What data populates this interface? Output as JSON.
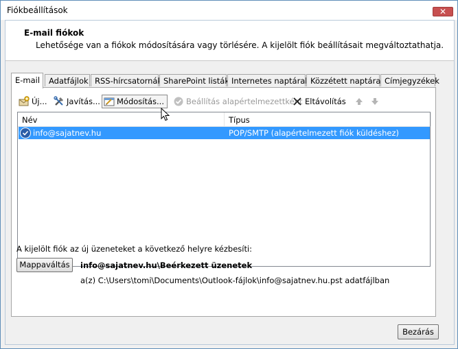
{
  "window": {
    "title": "Fiókbeállítások",
    "close_glyph": "✕"
  },
  "header": {
    "title": "E-mail fiókok",
    "description": "Lehetősége van a fiókok módosítására vagy törlésére. A kijelölt fiók beállításait megváltoztathatja."
  },
  "tabs": [
    {
      "label": "E-mail",
      "active": true
    },
    {
      "label": "Adatfájlok"
    },
    {
      "label": "RSS-hírcsatornák"
    },
    {
      "label": "SharePoint listák"
    },
    {
      "label": "Internetes naptárak"
    },
    {
      "label": "Közzétett naptárak"
    },
    {
      "label": "Címjegyzékek"
    }
  ],
  "toolbar": {
    "new_label": "Új...",
    "repair_label": "Javítás...",
    "change_label": "Módosítás...",
    "set_default_label": "Beállítás alapértelmezettként",
    "remove_label": "Eltávolítás"
  },
  "list": {
    "columns": {
      "name": "Név",
      "type": "Típus"
    },
    "rows": [
      {
        "name": "info@sajatnev.hu",
        "type": "POP/SMTP (alapértelmezett fiók küldéshez)",
        "selected": true
      }
    ]
  },
  "delivery": {
    "label": "A kijelölt fiók az új üzeneteket a következő helyre kézbesíti:",
    "change_folder_label": "Mappaváltás",
    "folder": "info@sajatnev.hu\\Beérkezett üzenetek",
    "path": "a(z) C:\\Users\\tomi\\Documents\\Outlook-fájlok\\info@sajatnev.hu.pst adatfájlban"
  },
  "footer": {
    "close_label": "Bezárás"
  },
  "colors": {
    "selection": "#3399ff",
    "close_button": "#c75050"
  }
}
